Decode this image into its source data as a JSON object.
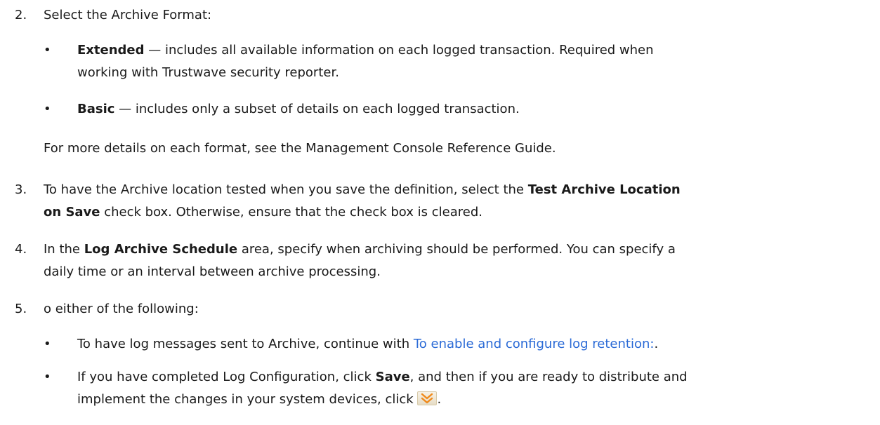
{
  "step2": {
    "number": "2.",
    "text": "Select the Archive Format:",
    "bullet1": {
      "bold": "Extended",
      "text_line1": " — includes all available information on each logged transaction. Required when",
      "text_line2": "working with Trustwave security reporter."
    },
    "bullet2": {
      "bold": "Basic",
      "text": " — includes only a subset of details on each logged transaction."
    },
    "note": "For more details on each format, see the Management Console Reference Guide."
  },
  "step3": {
    "number": "3.",
    "pre": "To have the Archive location tested when you save the definition, select the ",
    "bold_line1": "Test Archive Location",
    "bold_line2": "on Save",
    "post": " check box. Otherwise, ensure that the check box is cleared."
  },
  "step4": {
    "number": "4.",
    "pre": "In the ",
    "bold": "Log Archive Schedule",
    "post_line1": " area, specify when archiving should be performed. You can specify a",
    "line2": "daily time or an interval between archive processing."
  },
  "step5": {
    "number": "5.",
    "text": "o either of the following:",
    "bullet1": {
      "pre": "To have log messages sent to Archive, continue with ",
      "link": "To enable and configure log retention:",
      "post": "."
    },
    "bullet2": {
      "pre": "If you have completed Log Configuration, click ",
      "bold": "Save",
      "post_line1": ", and then if you are ready to distribute and",
      "line2_pre": "implement the changes in your system devices, click ",
      "line2_post": "."
    }
  },
  "colors": {
    "text": "#1a1a1a",
    "link": "#2a6ad6",
    "icon_chevron": "#f08a1c"
  },
  "icons": {
    "deploy": "double-chevron-down-icon"
  }
}
